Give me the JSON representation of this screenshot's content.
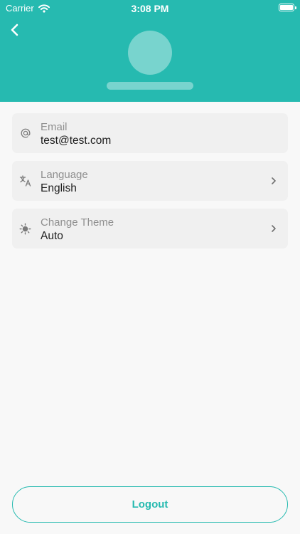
{
  "status_bar": {
    "carrier": "Carrier",
    "time": "3:08 PM"
  },
  "profile": {
    "avatar_icon": "avatar-placeholder",
    "name_icon": "name-placeholder"
  },
  "settings": {
    "email": {
      "icon": "at-sign-icon",
      "label": "Email",
      "value": "test@test.com"
    },
    "language": {
      "icon": "translate-icon",
      "label": "Language",
      "value": "English"
    },
    "theme": {
      "icon": "theme-icon",
      "label": "Change Theme",
      "value": "Auto"
    }
  },
  "actions": {
    "logout_label": "Logout"
  },
  "colors": {
    "accent": "#26bab0",
    "background": "#f8f8f8",
    "card": "#f0f0f0"
  }
}
